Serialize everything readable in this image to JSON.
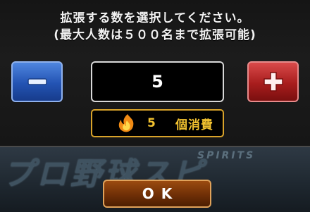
{
  "dialog": {
    "instruction_line1": "拡張する数を選択してください。",
    "instruction_line2": "(最大人数は５００名まで拡張可能)"
  },
  "stepper": {
    "value": "5",
    "minus_icon": "minus-icon",
    "plus_icon": "plus-icon"
  },
  "consume": {
    "icon": "flame-icon",
    "count": "5",
    "unit": "個消費"
  },
  "background": {
    "logo_text": "プロ野球スピ",
    "logo_sub": "SPIRITS"
  },
  "ok_button": {
    "label": "OK"
  },
  "colors": {
    "minus_button": "#2353b3",
    "plus_button": "#a81d1d",
    "consume_accent": "#f2c230",
    "ok_button": "#6f2f06"
  }
}
